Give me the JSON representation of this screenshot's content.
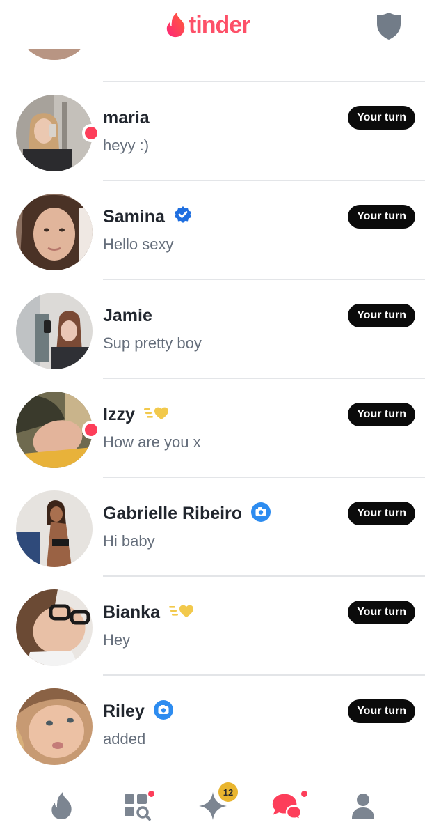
{
  "app": {
    "brand_name": "tinder",
    "brand_color": "#fd5068"
  },
  "header": {
    "logo_icon": "flame-icon",
    "safety_icon": "shield-icon"
  },
  "conversations": [
    {
      "name": "",
      "message": "",
      "turn_label": "",
      "online": false,
      "badge": "super-like-heart-icon",
      "partial": true
    },
    {
      "name": "maria",
      "message": "heyy :)",
      "turn_label": "Your turn",
      "online": true,
      "badge": ""
    },
    {
      "name": "Samina",
      "message": "Hello sexy",
      "turn_label": "Your turn",
      "online": false,
      "badge": "verified-check-icon"
    },
    {
      "name": "Jamie",
      "message": "Sup pretty boy",
      "turn_label": "Your turn",
      "online": false,
      "badge": ""
    },
    {
      "name": "Izzy",
      "message": "How are you x",
      "turn_label": "Your turn",
      "online": true,
      "badge": "super-like-heart-icon"
    },
    {
      "name": "Gabrielle Ribeiro",
      "message": "Hi baby",
      "turn_label": "Your turn",
      "online": false,
      "badge": "camera-icon"
    },
    {
      "name": "Bianka",
      "message": "Hey",
      "turn_label": "Your turn",
      "online": false,
      "badge": "super-like-heart-icon"
    },
    {
      "name": "Riley",
      "message": "added",
      "turn_label": "Your turn",
      "online": false,
      "badge": "camera-icon"
    }
  ],
  "bottom_nav": {
    "items": [
      "flame-icon",
      "explore-icon",
      "sparkle-icon",
      "messages-icon",
      "profile-icon"
    ],
    "likes_count": "12",
    "active": "messages-icon"
  },
  "colors": {
    "online_dot": "#fd3e5a",
    "verified": "#1f6fe0",
    "camera_badge": "#2d8cf0",
    "gold": "#f2c94c",
    "active_nav": "#fd3e5a",
    "inactive_nav": "#7c8591"
  }
}
